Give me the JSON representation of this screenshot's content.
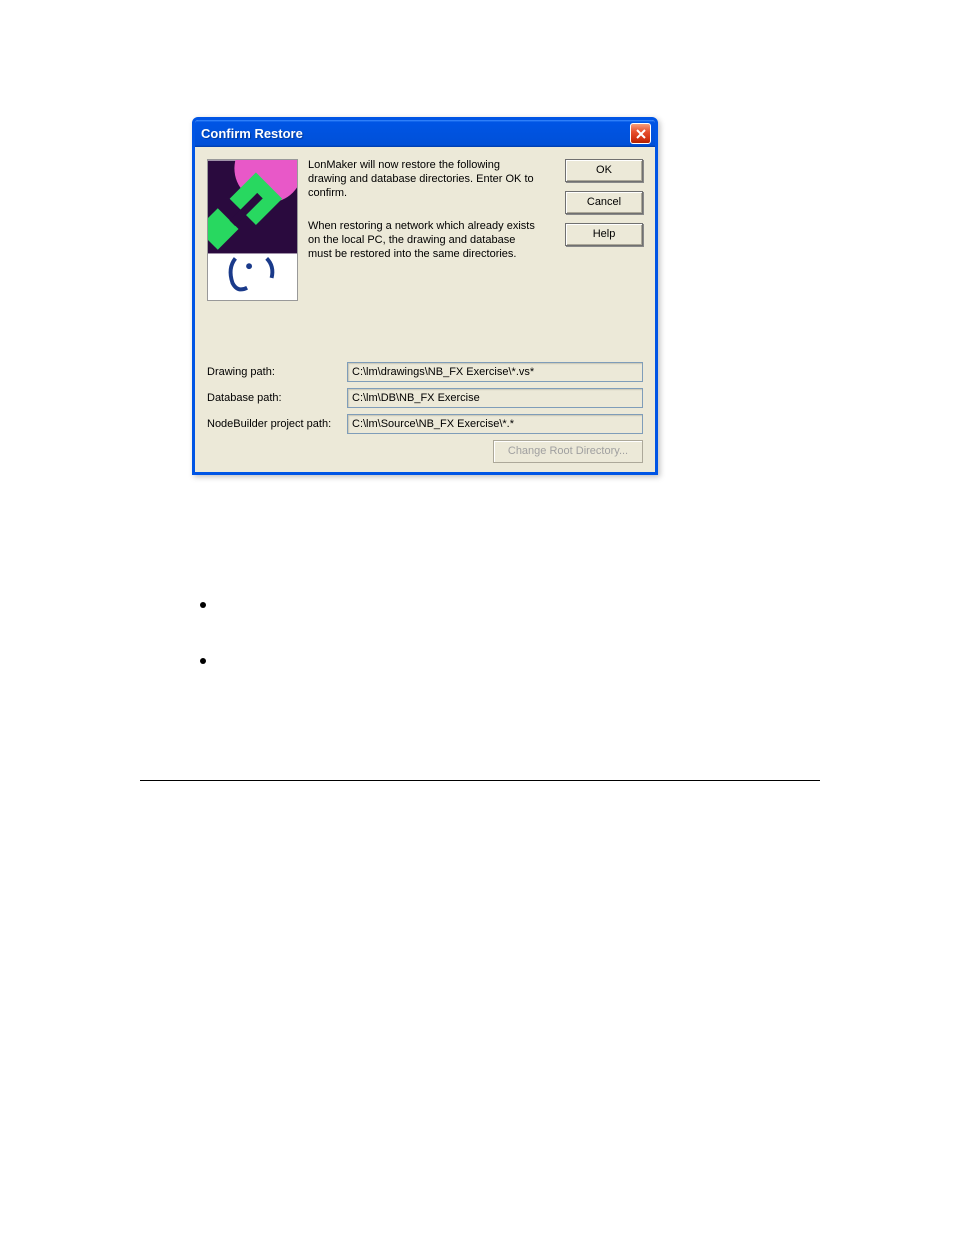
{
  "dialog": {
    "title": "Confirm Restore",
    "msg1": "LonMaker will now restore the following drawing and database directories.  Enter OK to confirm.",
    "msg2": "When restoring a network which already exists on the local PC, the drawing and database must be restored into the same directories.",
    "buttons": {
      "ok": "OK",
      "cancel": "Cancel",
      "help": "Help"
    },
    "paths": {
      "drawing_label": "Drawing path:",
      "drawing_value": "C:\\lm\\drawings\\NB_FX Exercise\\*.vs*",
      "database_label": "Database path:",
      "database_value": "C:\\lm\\DB\\NB_FX Exercise",
      "nodebuilder_label": "NodeBuilder project path:",
      "nodebuilder_value": "C:\\lm\\Source\\NB_FX Exercise\\*.*"
    },
    "change_root": "Change Root Directory..."
  }
}
